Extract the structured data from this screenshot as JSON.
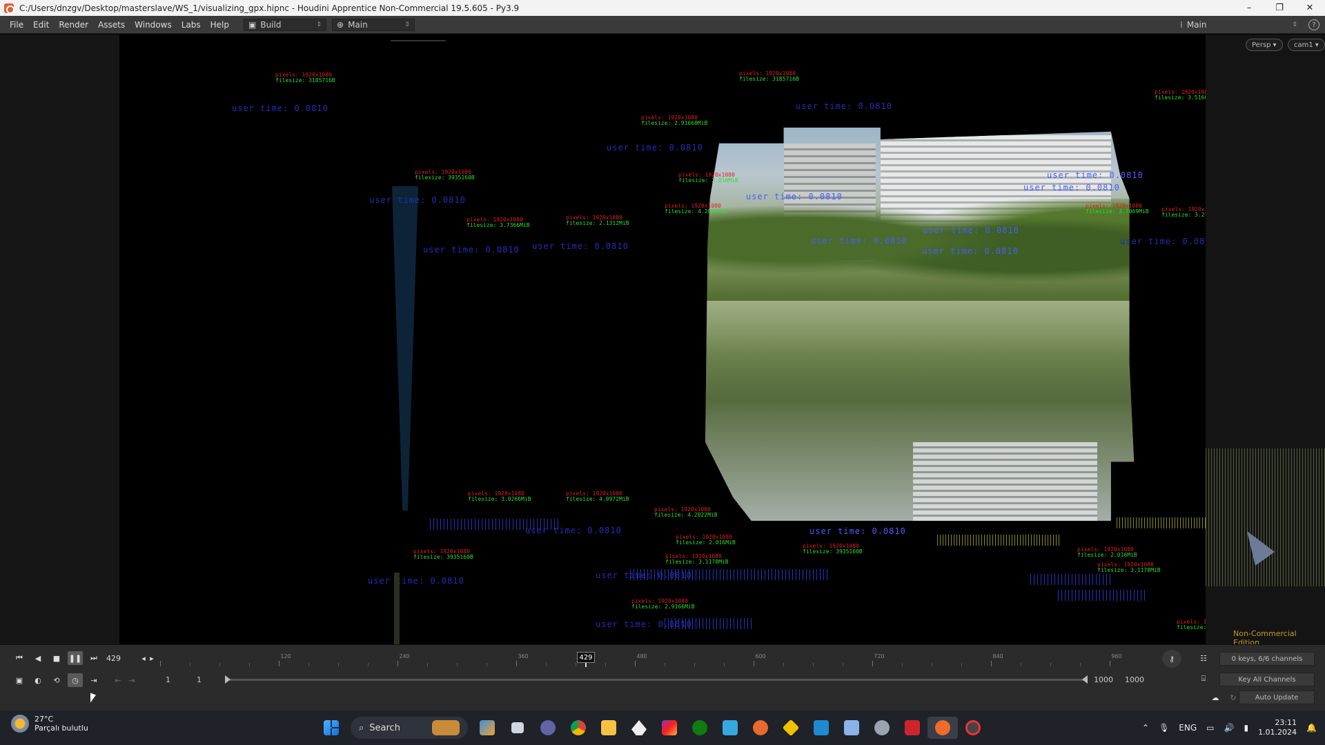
{
  "window": {
    "title": "C:/Users/dnzgv/Desktop/masterslave/WS_1/visualizing_gpx.hipnc - Houdini Apprentice Non-Commercial 19.5.605 - Py3.9",
    "minimize": "–",
    "maximize": "❐",
    "close": "✕"
  },
  "menu": {
    "items": [
      "File",
      "Edit",
      "Render",
      "Assets",
      "Windows",
      "Labs",
      "Help"
    ],
    "desktop": "Build",
    "network": "Main",
    "right_desktop": "Main",
    "help": "?"
  },
  "viewport": {
    "persp": "Persp",
    "cam": "cam1",
    "edition": "Non-Commercial Edition",
    "user_time_label": "user time: 0.0810"
  },
  "timeline": {
    "current_frame": "429",
    "playhead_label": "429",
    "ruler_labels": [
      "120",
      "240",
      "360",
      "480",
      "600",
      "720",
      "840",
      "960"
    ],
    "keys_info": "0 keys, 6/6 channels",
    "key_all": "Key All Channels",
    "start_a": "1",
    "start_b": "1",
    "end_a": "1000",
    "end_b": "1000",
    "auto_update": "Auto Update"
  },
  "taskbar": {
    "temp": "27°C",
    "weather": "Parçalı bulutlu",
    "search": "Search",
    "lang": "ENG",
    "time": "23:11",
    "date": "1.01.2024"
  },
  "colors": {
    "accent_red": "#e02020",
    "accent_green": "#28e028",
    "user_time_blue": "#2030b8",
    "edition_gold": "#c59a20"
  }
}
